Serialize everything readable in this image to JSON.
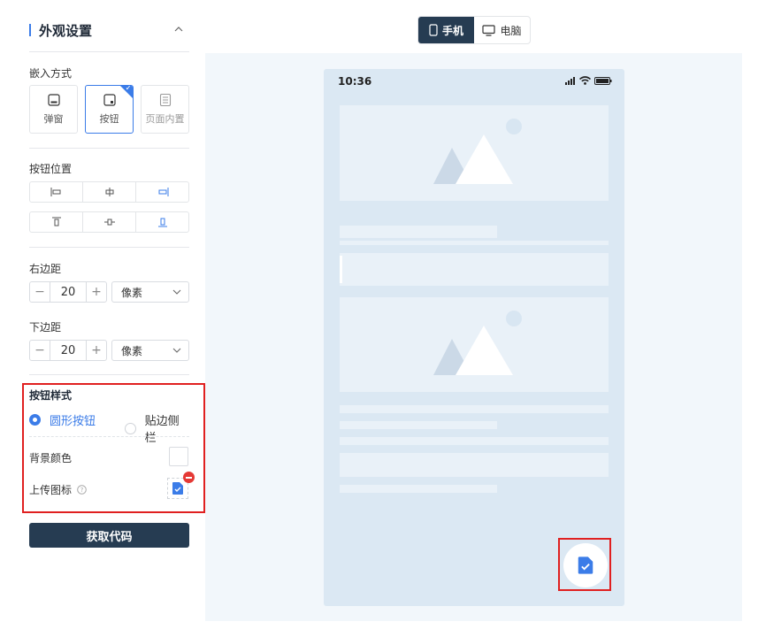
{
  "panel": {
    "title": "外观设置",
    "embed_label": "嵌入方式",
    "embed_options": [
      {
        "label": "弹窗",
        "icon": "popup-icon"
      },
      {
        "label": "按钮",
        "icon": "button-icon",
        "selected": true
      },
      {
        "label": "页面内置",
        "icon": "page-embed-icon",
        "disabled": true
      }
    ],
    "position_label": "按钮位置",
    "position_selected": "bottom-right",
    "right_margin": {
      "label": "右边距",
      "value": "20",
      "unit": "像素"
    },
    "bottom_margin": {
      "label": "下边距",
      "value": "20",
      "unit": "像素"
    },
    "button_style": {
      "label": "按钮样式",
      "options": [
        {
          "label": "圆形按钮",
          "selected": true
        },
        {
          "label": "贴边侧栏",
          "selected": false
        }
      ],
      "bg_color_label": "背景颜色",
      "upload_icon_label": "上传图标",
      "help_icon": "question-icon"
    },
    "get_code_label": "获取代码"
  },
  "preview": {
    "device_options": [
      {
        "label": "手机",
        "icon": "phone-icon",
        "active": true
      },
      {
        "label": "电脑",
        "icon": "monitor-icon",
        "active": false
      }
    ],
    "phone_time": "10:36"
  },
  "colors": {
    "accent": "#3b7ce8",
    "dark_button": "#263c52",
    "highlight_red": "#e02020",
    "phone_bg": "#dbe8f3"
  }
}
